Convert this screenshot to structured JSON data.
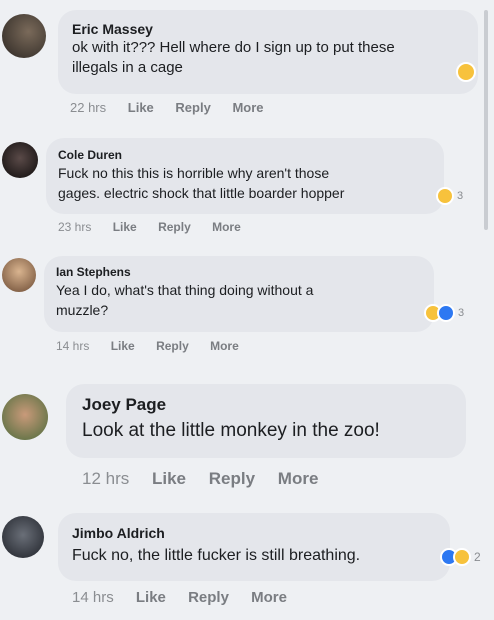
{
  "comments": [
    {
      "name": "Eric Massey",
      "text_lines": [
        "ok with it??? Hell where do I sign up to put these",
        "illegals in a cage"
      ],
      "time": "22 hrs",
      "like": "Like",
      "reply": "Reply",
      "more": "More",
      "reaction_count": ""
    },
    {
      "name": "Cole Duren",
      "text_lines": [
        "Fuck no this this is horrible why aren't those",
        "gages. electric shock that little boarder hopper"
      ],
      "time": "23 hrs",
      "like": "Like",
      "reply": "Reply",
      "more": "More",
      "reaction_count": "3"
    },
    {
      "name": "Ian Stephens",
      "text_lines": [
        "Yea I do, what's that thing doing without a",
        "muzzle?"
      ],
      "time": "14 hrs",
      "like": "Like",
      "reply": "Reply",
      "more": "More",
      "reaction_count": "3"
    },
    {
      "name": "Joey Page",
      "text_lines": [
        "Look at the little monkey in the zoo!"
      ],
      "time": "12 hrs",
      "like": "Like",
      "reply": "Reply",
      "more": "More",
      "reaction_count": ""
    },
    {
      "name": "Jimbo Aldrich",
      "text_lines": [
        "Fuck no, the little fucker is still breathing."
      ],
      "time": "14 hrs",
      "like": "Like",
      "reply": "Reply",
      "more": "More",
      "reaction_count": "2"
    }
  ],
  "colors": {
    "bubble": "#e4e6eb",
    "meta_text": "#8a8d91",
    "haha_emoji": "#f7c23c",
    "like_blue": "#2d78f2"
  },
  "icons": [
    "avatar",
    "haha-reaction-icon",
    "like-reaction-icon"
  ]
}
